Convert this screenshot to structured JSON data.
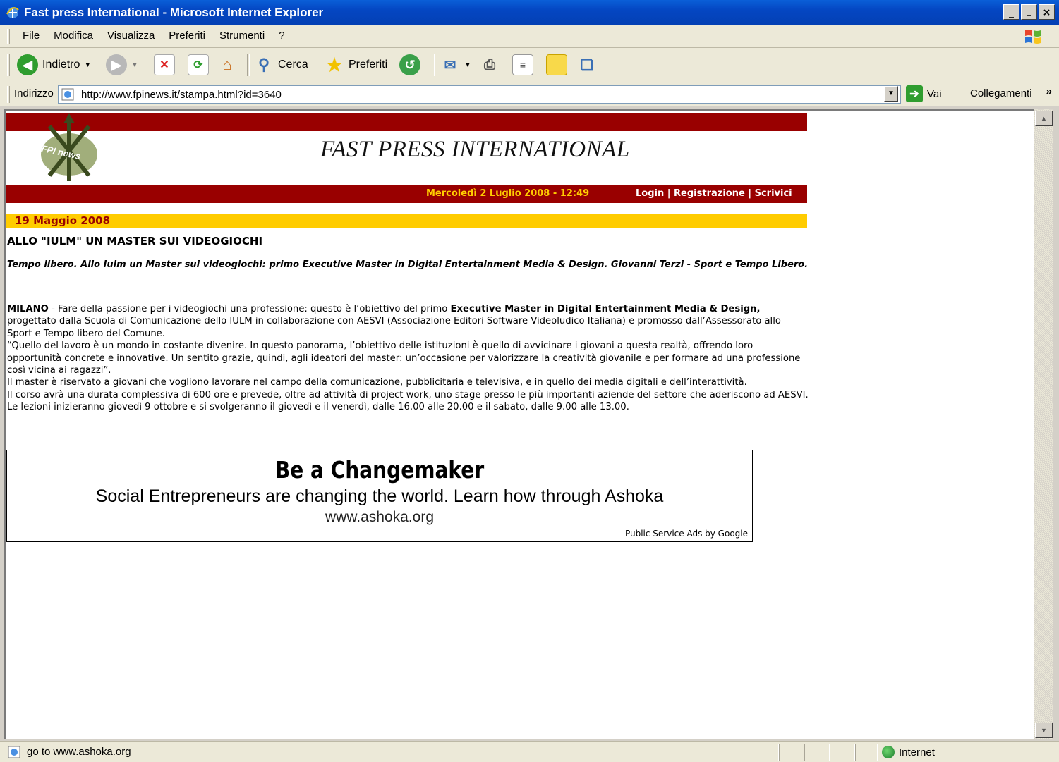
{
  "window": {
    "title": "Fast press International - Microsoft Internet Explorer"
  },
  "menu": [
    "File",
    "Modifica",
    "Visualizza",
    "Preferiti",
    "Strumenti",
    "?"
  ],
  "toolbar": {
    "back_label": "Indietro",
    "search_label": "Cerca",
    "favorites_label": "Preferiti"
  },
  "address": {
    "label": "Indirizzo",
    "url": "http://www.fpinews.it/stampa.html?id=3640",
    "go_label": "Vai",
    "links_label": "Collegamenti"
  },
  "page": {
    "site_title": "FAST PRESS INTERNATIONAL",
    "logo_text": "FPI news",
    "current_datetime": "Mercoledì 2 Luglio 2008 - 12:49",
    "links": {
      "login": "Login",
      "sep1": " | ",
      "register": "Registrazione",
      "sep2": " | ",
      "write": "Scrivici"
    },
    "article_date": "19 Maggio 2008",
    "headline": "ALLO \"IULM\" UN MASTER SUI VIDEOGIOCHI",
    "subhead": "Tempo libero. Allo Iulm un Master sui videogiochi: primo Executive Master in Digital Entertainment Media & Design. Giovanni Terzi - Sport e Tempo Libero.",
    "body": {
      "p1_lead": "MILANO",
      "p1_a": " - Fare della passione per i videogiochi una professione: questo è l’obiettivo del primo ",
      "p1_bold": "Executive Master in Digital Entertainment Media & Design,",
      "p1_b": " progettato dalla Scuola di Comunicazione dello IULM in collaborazione con AESVI (Associazione Editori Software Videoludico Italiana) e promosso dall’Assessorato allo Sport e Tempo libero del Comune.",
      "p2": "“Quello del lavoro è un mondo in costante divenire. In questo panorama, l’obiettivo delle istituzioni è quello di avvicinare i giovani a questa realtà, offrendo loro opportunità concrete e innovative. Un sentito grazie, quindi, agli ideatori del master: un’occasione per valorizzare la creatività giovanile e per formare ad una professione così vicina ai ragazzi”.",
      "p3": "Il master è riservato a giovani che vogliono lavorare nel campo della comunicazione, pubblicitaria e televisiva, e in quello dei media digitali e dell’interattività.",
      "p4": "Il corso avrà una durata complessiva di 600 ore e prevede, oltre ad attività di project work, uno stage presso le più importanti aziende del settore che aderiscono ad AESVI.",
      "p5": "Le lezioni inizieranno giovedì 9 ottobre e si svolgeranno il giovedì e il venerdì, dalle 16.00 alle 20.00 e il sabato, dalle 9.00 alle 13.00."
    },
    "ad": {
      "title": "Be a Changemaker",
      "line": "Social Entrepreneurs are changing the world. Learn how through Ashoka",
      "url": "www.ashoka.org",
      "credit": "Public Service Ads by Google"
    }
  },
  "status": {
    "text": "go to www.ashoka.org",
    "zone": "Internet"
  },
  "colors": {
    "banner": "#990000",
    "datebar": "#ffcc00",
    "titlebar": "#0446c2"
  }
}
